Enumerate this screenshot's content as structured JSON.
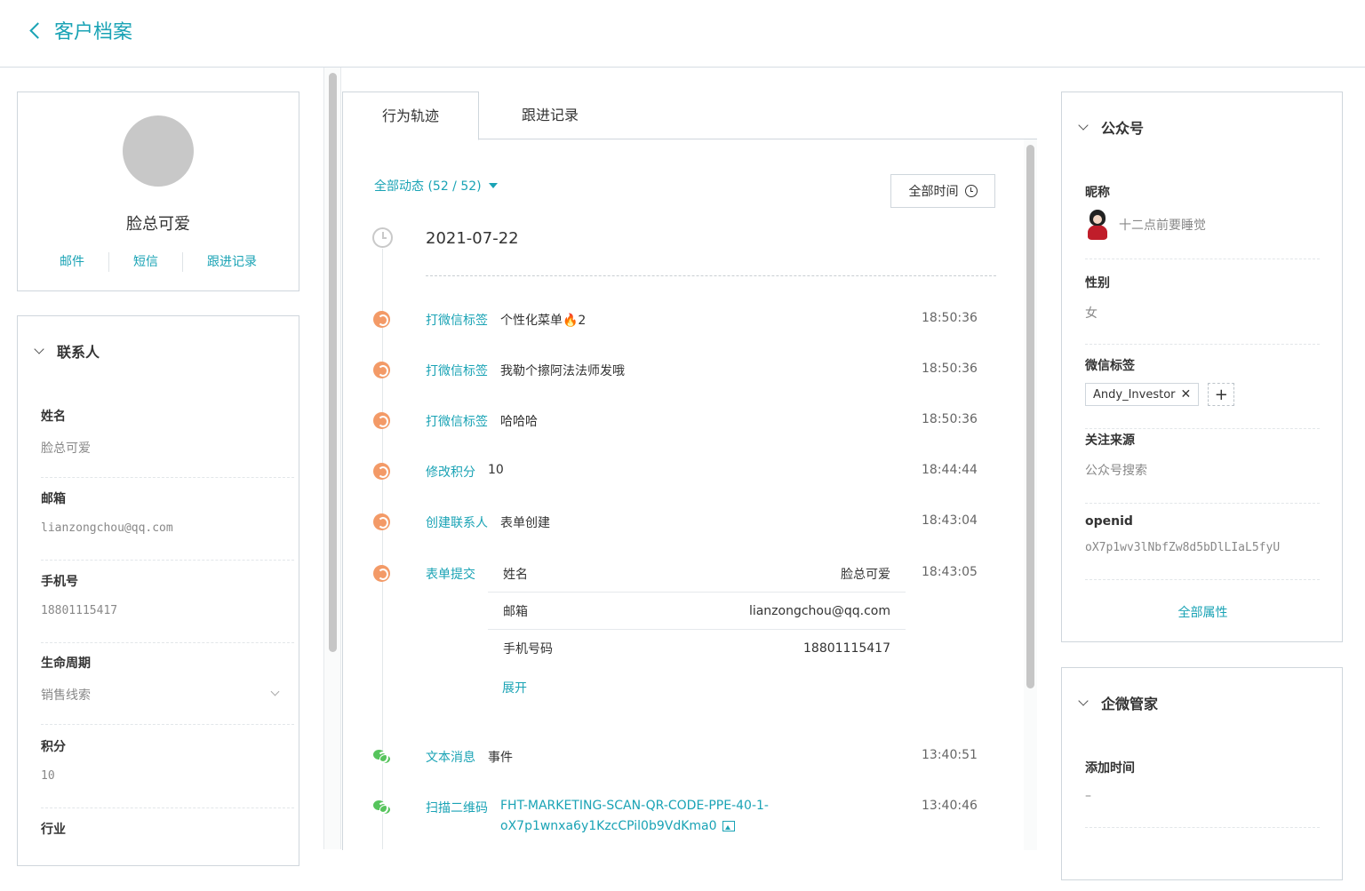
{
  "header": {
    "title": "客户档案"
  },
  "profile": {
    "name": "脸总可爱",
    "actions": [
      "邮件",
      "短信",
      "跟进记录"
    ]
  },
  "contacts": {
    "title": "联系人",
    "fields": [
      {
        "label": "姓名",
        "value": "脸总可爱"
      },
      {
        "label": "邮箱",
        "value": "lianzongchou@qq.com"
      },
      {
        "label": "手机号",
        "value": "18801115417"
      },
      {
        "label": "生命周期",
        "value": "销售线索"
      },
      {
        "label": "积分",
        "value": "10"
      },
      {
        "label": "行业",
        "value": ""
      }
    ]
  },
  "tabs": [
    {
      "label": "行为轨迹"
    },
    {
      "label": "跟进记录"
    }
  ],
  "timeline": {
    "filter_label": "全部动态 (52 / 52)",
    "time_button": "全部时间",
    "date": "2021-07-22",
    "events": [
      {
        "type": "打微信标签",
        "detail": "个性化菜单🔥2",
        "time": "18:50:36"
      },
      {
        "type": "打微信标签",
        "detail": "我勒个擦阿法法师发哦",
        "time": "18:50:36"
      },
      {
        "type": "打微信标签",
        "detail": "哈哈哈",
        "time": "18:50:36"
      },
      {
        "type": "修改积分",
        "detail": "10",
        "time": "18:44:44"
      },
      {
        "type": "创建联系人",
        "detail": "表单创建",
        "time": "18:43:04"
      },
      {
        "type": "表单提交",
        "detail": "",
        "time": "18:43:05"
      },
      {
        "type": "文本消息",
        "detail": "事件",
        "time": "13:40:51"
      },
      {
        "type": "扫描二维码",
        "detail": "FHT-MARKETING-SCAN-QR-CODE-PPE-40-1-",
        "time": "13:40:46"
      }
    ],
    "form_rows": [
      {
        "key": "姓名",
        "value": "脸总可爱"
      },
      {
        "key": "邮箱",
        "value": "lianzongchou@qq.com"
      },
      {
        "key": "手机号码",
        "value": "18801115417"
      }
    ],
    "expand_label": "展开",
    "qr_line2": "oX7p1wnxa6y1KzcCPil0b9VdKma0"
  },
  "wechat": {
    "title": "公众号",
    "nickname_label": "昵称",
    "nickname": "十二点前要睡觉",
    "gender_label": "性别",
    "gender": "女",
    "tags_label": "微信标签",
    "tag": "Andy_Investor",
    "source_label": "关注来源",
    "source": "公众号搜索",
    "openid_label": "openid",
    "openid": "oX7p1wv3lNbfZw8d5bDlLIaL5fyU",
    "all_attrs": "全部属性"
  },
  "qiwei": {
    "title": "企微管家",
    "add_time_label": "添加时间",
    "add_time": "–"
  },
  "colors": {
    "accent": "#1aa3b5",
    "event_orange": "#f39a67",
    "wechat_green": "#56c45c"
  }
}
